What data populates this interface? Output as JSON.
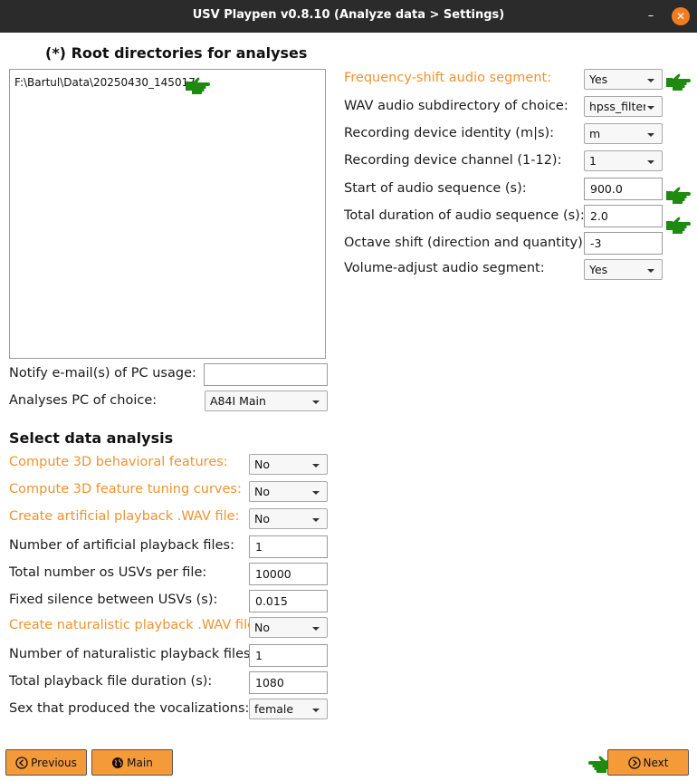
{
  "window": {
    "title": "USV Playpen v0.8.10 (Analyze data > Settings)",
    "minimize_glyph": "–",
    "close_glyph": "✕"
  },
  "colors": {
    "accent_orange": "#f0922e",
    "button_orange": "#f59a39",
    "hand_green": "#1e8a10",
    "titlebar": "#2b2b2b"
  },
  "root_dirs": {
    "heading": "(*) Root directories for analyses",
    "entries": [
      "F:\\Bartul\\Data\\20250430_145017"
    ]
  },
  "notify_email": {
    "label": "Notify e-mail(s) of PC usage:",
    "value": ""
  },
  "analyses_pc": {
    "label": "Analyses PC of choice:",
    "value": "A84I Main"
  },
  "select_heading": "Select data analysis",
  "analysis": {
    "compute_3d_features": {
      "label": "Compute 3D behavioral features:",
      "value": "No"
    },
    "compute_3d_tuning": {
      "label": "Compute 3D feature tuning curves:",
      "value": "No"
    },
    "create_artificial_wav": {
      "label": "Create artificial playback .WAV file:",
      "value": "No"
    },
    "num_artificial_files": {
      "label": "Number of artificial playback files:",
      "value": "1"
    },
    "total_usvs_per_file": {
      "label": "Total number os USVs per file:",
      "value": "10000"
    },
    "fixed_silence": {
      "label": "Fixed silence between USVs (s):",
      "value": "0.015"
    },
    "create_naturalistic_wav": {
      "label": "Create naturalistic playback .WAV file:",
      "value": "No"
    },
    "num_naturalistic_files": {
      "label": "Number of naturalistic playback files:",
      "value": "1"
    },
    "total_playback_duration": {
      "label": "Total playback file duration (s):",
      "value": "1080"
    },
    "sex_vocalizations": {
      "label": "Sex that produced the vocalizations:",
      "value": "female"
    }
  },
  "freq_shift": {
    "frequency_shift": {
      "label": "Frequency-shift audio segment:",
      "value": "Yes"
    },
    "wav_subdirectory": {
      "label": "WAV audio subdirectory of choice:",
      "value": "hpss_filtered"
    },
    "device_identity": {
      "label": "Recording device identity (m|s):",
      "value": "m"
    },
    "device_channel": {
      "label": "Recording device channel (1-12):",
      "value": "1"
    },
    "start_sequence": {
      "label": "Start of audio sequence (s):",
      "value": "900.0"
    },
    "total_duration": {
      "label": "Total duration of audio sequence (s):",
      "value": "2.0"
    },
    "octave_shift": {
      "label": "Octave shift (direction and quantity):",
      "value": "-3"
    },
    "volume_adjust": {
      "label": "Volume-adjust audio segment:",
      "value": "Yes"
    }
  },
  "nav": {
    "previous": "Previous",
    "main": "Main",
    "next": "Next"
  },
  "icons": [
    "minimize-icon",
    "close-icon",
    "pointing-hand-icon",
    "chevron-down-icon",
    "circle-left-arrow-icon",
    "globe-icon",
    "circle-right-arrow-icon"
  ]
}
